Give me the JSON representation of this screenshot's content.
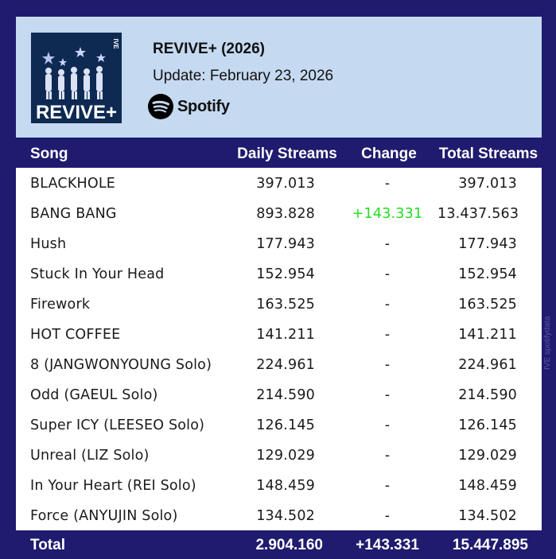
{
  "header": {
    "cover_text": "REVIVE+",
    "cover_tag": "IVE",
    "album_title": "REVIVE+ (2026)",
    "update_line": "Update: February 23, 2026",
    "platform_name": "Spotify",
    "spotify_color": "#000000"
  },
  "columns": {
    "song": "Song",
    "daily": "Daily Streams",
    "change": "Change",
    "total": "Total Streams"
  },
  "rows": [
    {
      "song": "BLACKHOLE",
      "daily": "397.013",
      "change": "-",
      "total": "397.013"
    },
    {
      "song": "BANG BANG",
      "daily": "893.828",
      "change": "+143.331",
      "total": "13.437.563"
    },
    {
      "song": "Hush",
      "daily": "177.943",
      "change": "-",
      "total": "177.943"
    },
    {
      "song": "Stuck In Your Head",
      "daily": "152.954",
      "change": "-",
      "total": "152.954"
    },
    {
      "song": "Firework",
      "daily": "163.525",
      "change": "-",
      "total": "163.525"
    },
    {
      "song": "HOT COFFEE",
      "daily": "141.211",
      "change": "-",
      "total": "141.211"
    },
    {
      "song": "8 (JANGWONYOUNG Solo)",
      "daily": "224.961",
      "change": "-",
      "total": "224.961"
    },
    {
      "song": "Odd (GAEUL Solo)",
      "daily": "214.590",
      "change": "-",
      "total": "214.590"
    },
    {
      "song": "Super ICY (LEESEO Solo)",
      "daily": "126.145",
      "change": "-",
      "total": "126.145"
    },
    {
      "song": "Unreal (LIZ Solo)",
      "daily": "129.029",
      "change": "-",
      "total": "129.029"
    },
    {
      "song": "In Your Heart (REI Solo)",
      "daily": "148.459",
      "change": "-",
      "total": "148.459"
    },
    {
      "song": "Force (ANYUJIN Solo)",
      "daily": "134.502",
      "change": "-",
      "total": "134.502"
    }
  ],
  "totals": {
    "label": "Total",
    "daily": "2.904.160",
    "change": "+143.331",
    "total": "15.447.895"
  },
  "watermark": "IVE spotifydata",
  "colors": {
    "frame": "#1f1b6e",
    "header_bg": "#c5d9f1",
    "positive_change": "#22dd22",
    "cover_bg": "#0e2a52"
  }
}
